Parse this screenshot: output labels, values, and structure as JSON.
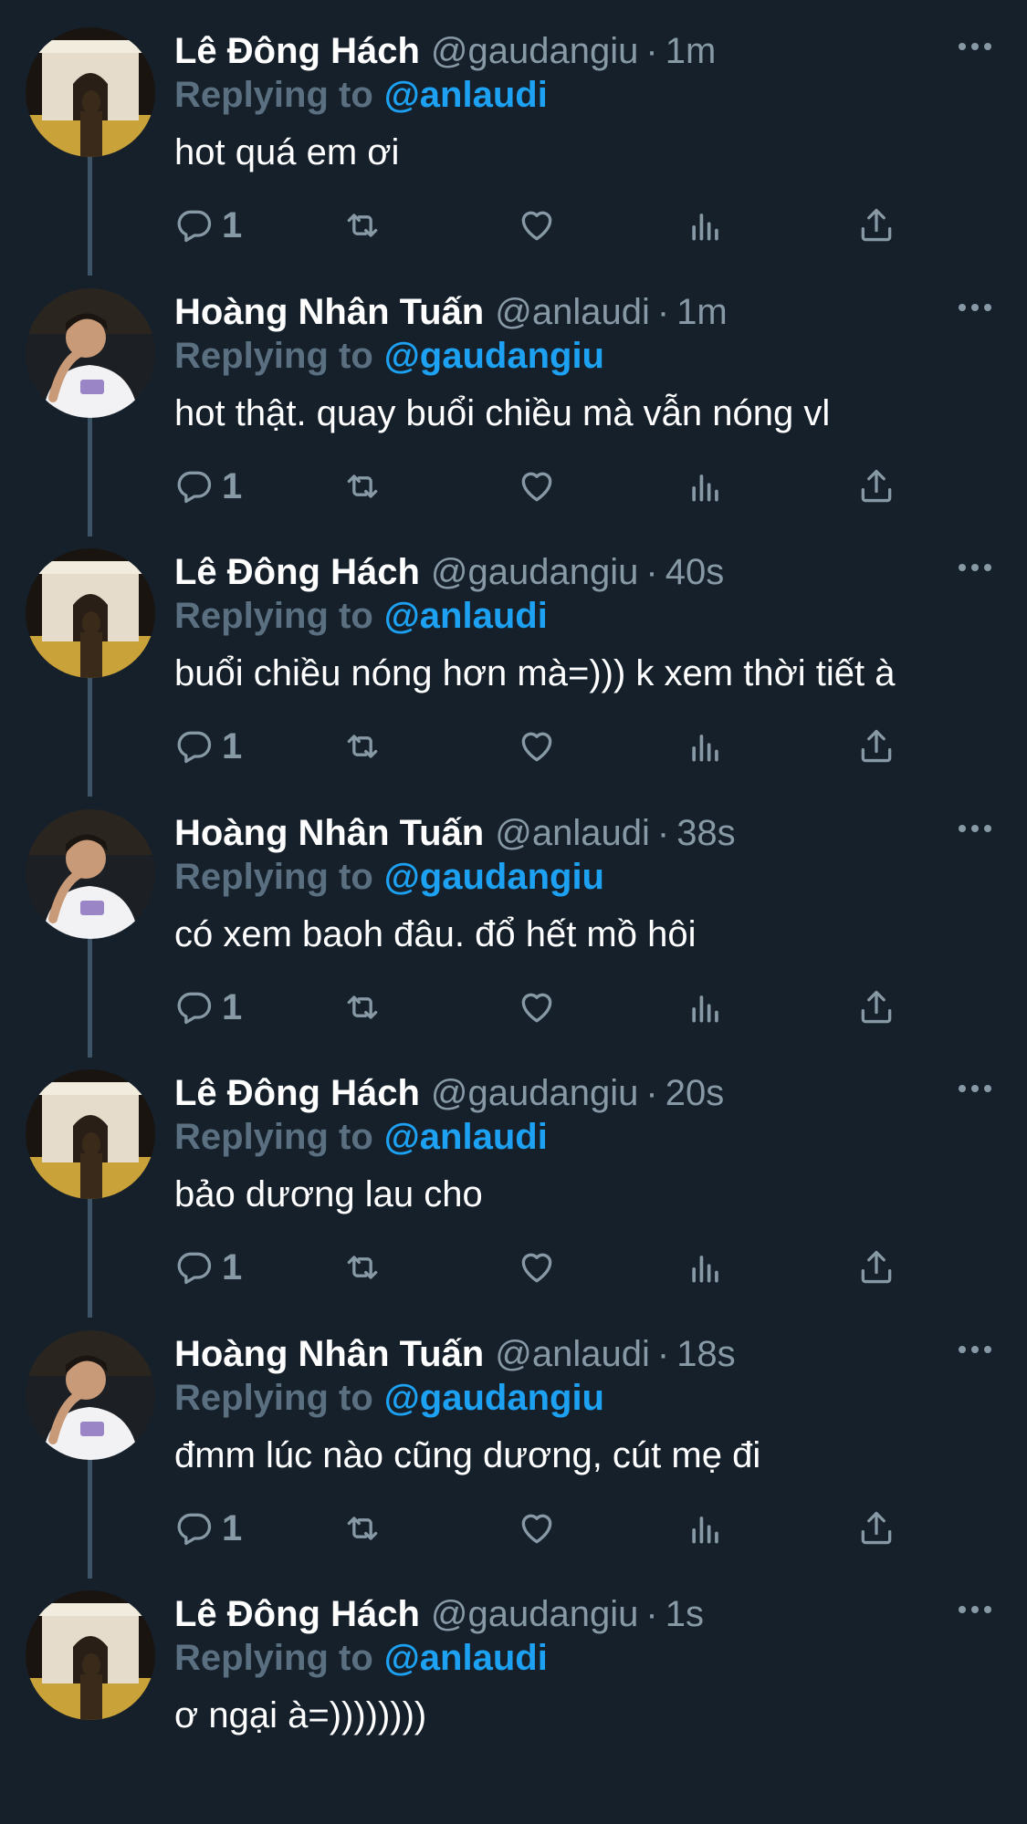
{
  "colors": {
    "background": "#15202b",
    "name": "#ffffff",
    "meta": "#8899a6",
    "replying_prefix": "#5a6f80",
    "link": "#1da1f2",
    "thread_line": "#3d5466"
  },
  "tweets": [
    {
      "avatar": "avatar-arch",
      "name": "Lê Đông Hách",
      "handle": "@gaudangiu",
      "dot": "·",
      "time": "1m",
      "reply_prefix": "Replying to",
      "reply_to": "@anlaudi",
      "text": "hot quá em ơi",
      "reply_count": "1"
    },
    {
      "avatar": "avatar-person",
      "name": "Hoàng Nhân Tuấn",
      "handle": "@anlaudi",
      "dot": "·",
      "time": "1m",
      "reply_prefix": "Replying to",
      "reply_to": "@gaudangiu",
      "text": "hot thật. quay buổi chiều mà vẫn nóng vl",
      "reply_count": "1"
    },
    {
      "avatar": "avatar-arch",
      "name": "Lê Đông Hách",
      "handle": "@gaudangiu",
      "dot": "·",
      "time": "40s",
      "reply_prefix": "Replying to",
      "reply_to": "@anlaudi",
      "text": "buổi chiều nóng hơn mà=))) k xem thời tiết à",
      "reply_count": "1"
    },
    {
      "avatar": "avatar-person",
      "name": "Hoàng Nhân Tuấn",
      "handle": "@anlaudi",
      "dot": "·",
      "time": "38s",
      "reply_prefix": "Replying to",
      "reply_to": "@gaudangiu",
      "text": "có xem baoh đâu. đổ hết mồ hôi",
      "reply_count": "1"
    },
    {
      "avatar": "avatar-arch",
      "name": "Lê Đông Hách",
      "handle": "@gaudangiu",
      "dot": "·",
      "time": "20s",
      "reply_prefix": "Replying to",
      "reply_to": "@anlaudi",
      "text": "bảo dương lau cho",
      "reply_count": "1"
    },
    {
      "avatar": "avatar-person",
      "name": "Hoàng Nhân Tuấn",
      "handle": "@anlaudi",
      "dot": "·",
      "time": "18s",
      "reply_prefix": "Replying to",
      "reply_to": "@gaudangiu",
      "text": "đmm lúc nào cũng dương, cút mẹ đi",
      "reply_count": "1"
    },
    {
      "avatar": "avatar-arch",
      "name": "Lê Đông Hách",
      "handle": "@gaudangiu",
      "dot": "·",
      "time": "1s",
      "reply_prefix": "Replying to",
      "reply_to": "@anlaudi",
      "text": "ơ ngại à=))))))))",
      "reply_count": ""
    }
  ]
}
